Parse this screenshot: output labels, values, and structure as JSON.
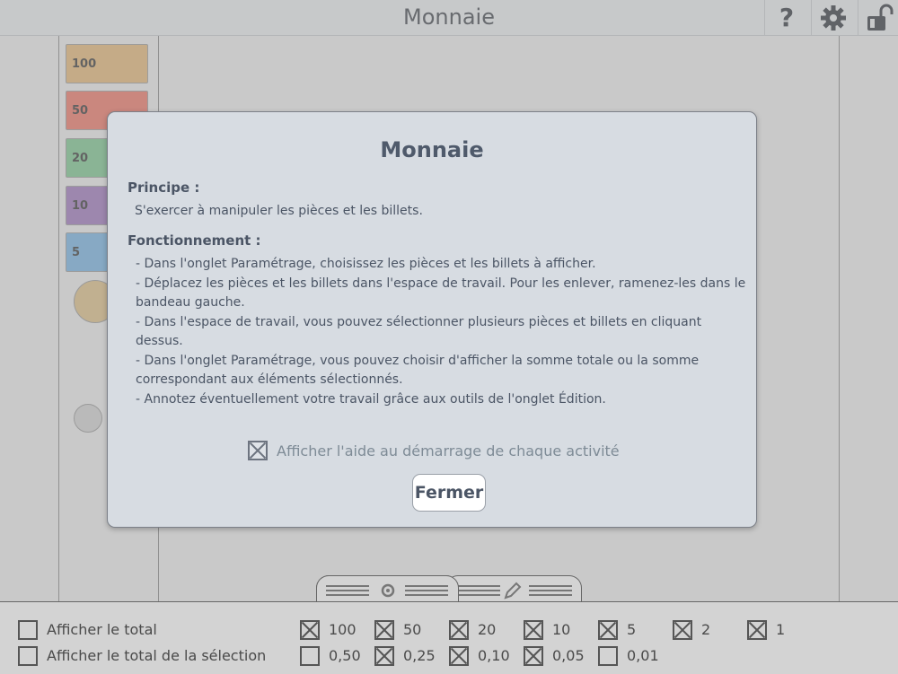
{
  "app": {
    "title": "Monnaie",
    "help_icon": "question-icon",
    "settings_icon": "gear-icon",
    "lock_icon": "unlocked-padlock-icon"
  },
  "sidebar": {
    "bills": [
      {
        "label": "100",
        "color": "#c9a16a"
      },
      {
        "label": "50",
        "color": "#d26b5d"
      },
      {
        "label": "20",
        "color": "#6fb080"
      },
      {
        "label": "10",
        "color": "#8c6ba6"
      },
      {
        "label": "5",
        "color": "#6a9fc8"
      }
    ]
  },
  "modal": {
    "title": "Monnaie",
    "principle_heading": "Principe :",
    "principle_text": "S'exercer à manipuler les pièces et les billets.",
    "operation_heading": "Fonctionnement :",
    "operation_lines": [
      "- Dans l'onglet Paramétrage, choisissez les pièces et les billets à afficher.",
      "- Déplacez les pièces et les billets dans l'espace de travail. Pour les enlever, ramenez-les dans le bandeau gauche.",
      "- Dans l'espace de travail, vous pouvez sélectionner plusieurs pièces et billets en cliquant dessus.",
      "- Dans l'onglet Paramétrage, vous pouvez choisir d'afficher la somme totale ou la somme correspondant aux éléments sélectionnés.",
      "- Annotez éventuellement votre travail grâce aux outils de l'onglet Édition."
    ],
    "startup_help_label": "Afficher l'aide au démarrage de chaque activité",
    "startup_help_checked": true,
    "close_label": "Fermer"
  },
  "bottom_panel": {
    "tabs": [
      {
        "name": "settings",
        "icon": "gear-icon"
      },
      {
        "name": "edit",
        "icon": "pencil-icon"
      }
    ],
    "options": [
      {
        "label": "Afficher le total",
        "checked": false
      },
      {
        "label": "Afficher le total de la sélection",
        "checked": false
      }
    ],
    "row1": [
      {
        "label": "100",
        "checked": true
      },
      {
        "label": "50",
        "checked": true
      },
      {
        "label": "20",
        "checked": true
      },
      {
        "label": "10",
        "checked": true
      },
      {
        "label": "5",
        "checked": true
      },
      {
        "label": "2",
        "checked": true
      },
      {
        "label": "1",
        "checked": true
      }
    ],
    "row2": [
      {
        "label": "0,50",
        "checked": false
      },
      {
        "label": "0,25",
        "checked": true
      },
      {
        "label": "0,10",
        "checked": true
      },
      {
        "label": "0,05",
        "checked": true
      },
      {
        "label": "0,01",
        "checked": false
      }
    ]
  },
  "colors": {
    "modal_bg": "#d7dce2",
    "modal_text": "#4b5565"
  }
}
